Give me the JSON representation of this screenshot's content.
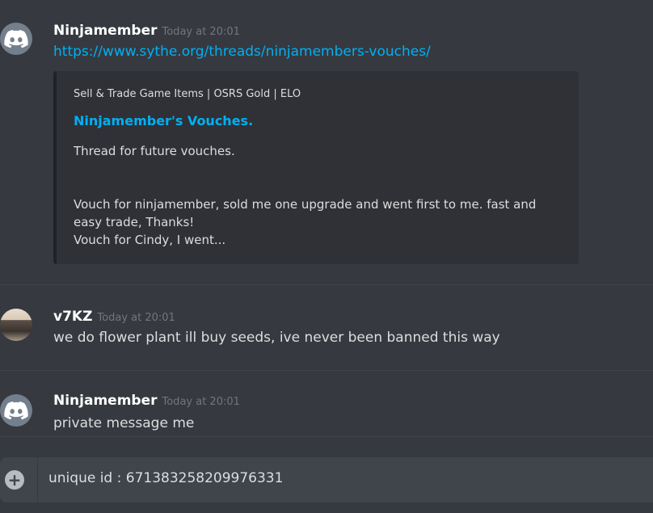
{
  "messages": [
    {
      "author": "Ninjamember",
      "timestamp": "Today at 20:01",
      "link": "https://www.sythe.org/threads/ninjamembers-vouches/",
      "embed": {
        "provider": "Sell & Trade Game Items | OSRS Gold | ELO",
        "title": "Ninjamember's Vouches.",
        "description_line1": "Thread for future vouches.",
        "description_line2": "Vouch for ninjamember, sold me one upgrade and went first to me. fast and easy trade, Thanks!",
        "description_line3": "Vouch for Cindy, I went..."
      },
      "avatar_icon": "discord-logo-icon"
    },
    {
      "author": "v7KZ",
      "timestamp": "Today at 20:01",
      "text": "we do flower plant ill buy seeds, ive never been banned this way",
      "avatar_icon": "user-photo"
    },
    {
      "author": "Ninjamember",
      "timestamp": "Today at 20:01",
      "text": "private message me",
      "avatar_icon": "discord-logo-icon"
    }
  ],
  "composer": {
    "value": "unique id : 671383258209976331",
    "attach_icon": "plus-circle-icon"
  },
  "colors": {
    "background": "#36393f",
    "embed_background": "#2f3136",
    "link": "#00b0f4",
    "author": "#ffffff",
    "timestamp": "#72767d",
    "composer_background": "#40444b"
  }
}
